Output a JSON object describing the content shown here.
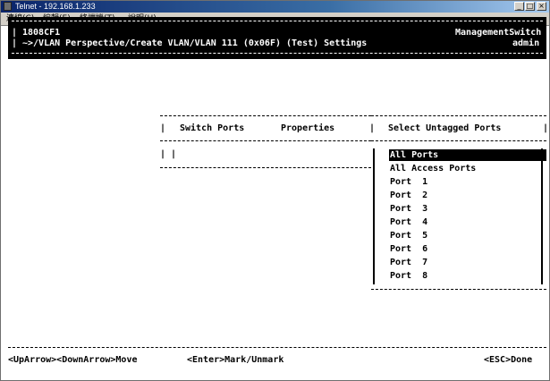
{
  "window": {
    "title": "Telnet - 192.168.1.233"
  },
  "menu": [
    "連線(C)",
    "編輯(E)",
    "終端機(T)",
    "說明(H)"
  ],
  "header": {
    "system_name": "1808CF1",
    "device": "ManagementSwitch",
    "path": "~>/VLAN Perspective/Create VLAN/VLAN 111 (0x06F) (Test) Settings",
    "user": "admin"
  },
  "left_panel": {
    "col1": "Switch Ports",
    "col2": "Properties",
    "row_marker": "| |"
  },
  "right_panel": {
    "title": "Select Untagged Ports",
    "items": [
      "All Ports",
      "All Access Ports",
      "Port  1",
      "Port  2",
      "Port  3",
      "Port  4",
      "Port  5",
      "Port  6",
      "Port  7",
      "Port  8"
    ],
    "selected_index": 0
  },
  "footer": {
    "navigation": "<UpArrow><DownArrow>Move",
    "mark": "<Enter>Mark/Unmark",
    "done": "<ESC>Done"
  }
}
